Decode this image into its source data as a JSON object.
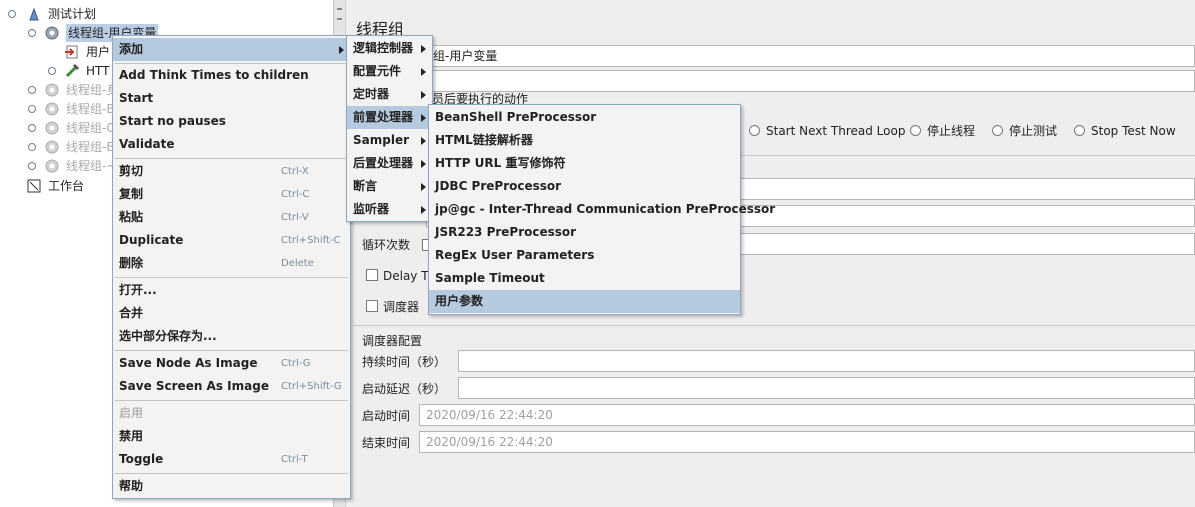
{
  "tree": {
    "root_label": "测试计划",
    "items": [
      {
        "label": "线程组-用户变量",
        "selected": true
      },
      {
        "label": "用户"
      },
      {
        "label": "HTT"
      },
      {
        "label": "线程组-身"
      },
      {
        "label": "线程组-B"
      },
      {
        "label": "线程组-C"
      },
      {
        "label": "线程组-E"
      },
      {
        "label": "线程组-~"
      }
    ],
    "workbench_label": "工作台"
  },
  "main": {
    "title": "线程组",
    "name_value": "组-用户变量",
    "action_group_label": "员后要执行的动作",
    "radios": [
      "Start Next Thread Loop",
      "停止线程",
      "停止测试",
      "Stop Test Now"
    ],
    "loop_label": "循环次数",
    "delay_label": "Delay Th",
    "scheduler_label": "调度器",
    "scheduler_config_title": "调度器配置",
    "duration_label": "持续时间（秒）",
    "startup_delay_label": "启动延迟（秒）",
    "start_time_label": "启动时间",
    "start_time_value": "2020/09/16 22:44:20",
    "end_time_label": "结束时间",
    "end_time_value": "2020/09/16 22:44:20"
  },
  "context_menu": {
    "add": "添加",
    "add_think_times": "Add Think Times to children",
    "start": "Start",
    "start_no_pauses": "Start no pauses",
    "validate": "Validate",
    "cut": "剪切",
    "cut_sc": "Ctrl-X",
    "copy": "复制",
    "copy_sc": "Ctrl-C",
    "paste": "粘贴",
    "paste_sc": "Ctrl-V",
    "duplicate": "Duplicate",
    "duplicate_sc": "Ctrl+Shift-C",
    "delete": "删除",
    "delete_sc": "Delete",
    "open": "打开...",
    "merge": "合并",
    "save_selection": "选中部分保存为...",
    "save_node_image": "Save Node As Image",
    "save_node_image_sc": "Ctrl-G",
    "save_screen_image": "Save Screen As Image",
    "save_screen_image_sc": "Ctrl+Shift-G",
    "enable": "启用",
    "disable": "禁用",
    "toggle": "Toggle",
    "toggle_sc": "Ctrl-T",
    "help": "帮助"
  },
  "add_submenu": {
    "items": [
      "逻辑控制器",
      "配置元件",
      "定时器",
      "前置处理器",
      "Sampler",
      "后置处理器",
      "断言",
      "监听器"
    ]
  },
  "preprocessor_submenu": {
    "items": [
      "BeanShell PreProcessor",
      "HTML链接解析器",
      "HTTP URL 重写修饰符",
      "JDBC PreProcessor",
      "jp@gc - Inter-Thread Communication PreProcessor",
      "JSR223 PreProcessor",
      "RegEx User Parameters",
      "Sample Timeout",
      "用户参数"
    ]
  }
}
